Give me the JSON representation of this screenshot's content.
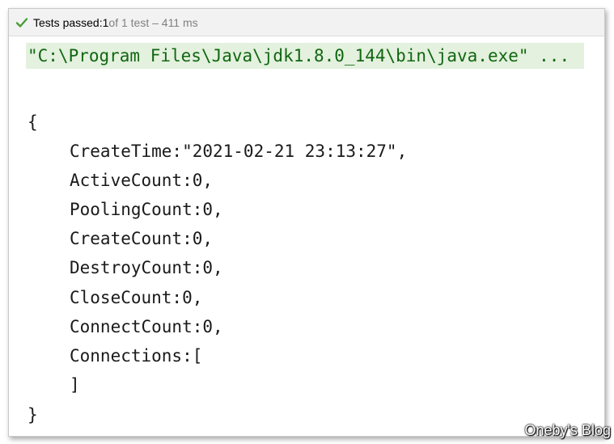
{
  "status": {
    "prefix": "Tests passed: ",
    "passed": "1",
    "rest": " of 1 test – 411 ms",
    "icon": "check-icon",
    "icon_color": "#4a9c3a"
  },
  "console": {
    "command": "\"C:\\Program Files\\Java\\jdk1.8.0_144\\bin\\java.exe\" ...",
    "command_bg": "#e3f1de",
    "open_brace": "{",
    "fields": [
      "CreateTime:\"2021-02-21 23:13:27\",",
      "ActiveCount:0,",
      "PoolingCount:0,",
      "CreateCount:0,",
      "DestroyCount:0,",
      "CloseCount:0,",
      "ConnectCount:0,",
      "Connections:[",
      "]"
    ],
    "close_brace": "}"
  },
  "watermark": "Oneby's Blog"
}
